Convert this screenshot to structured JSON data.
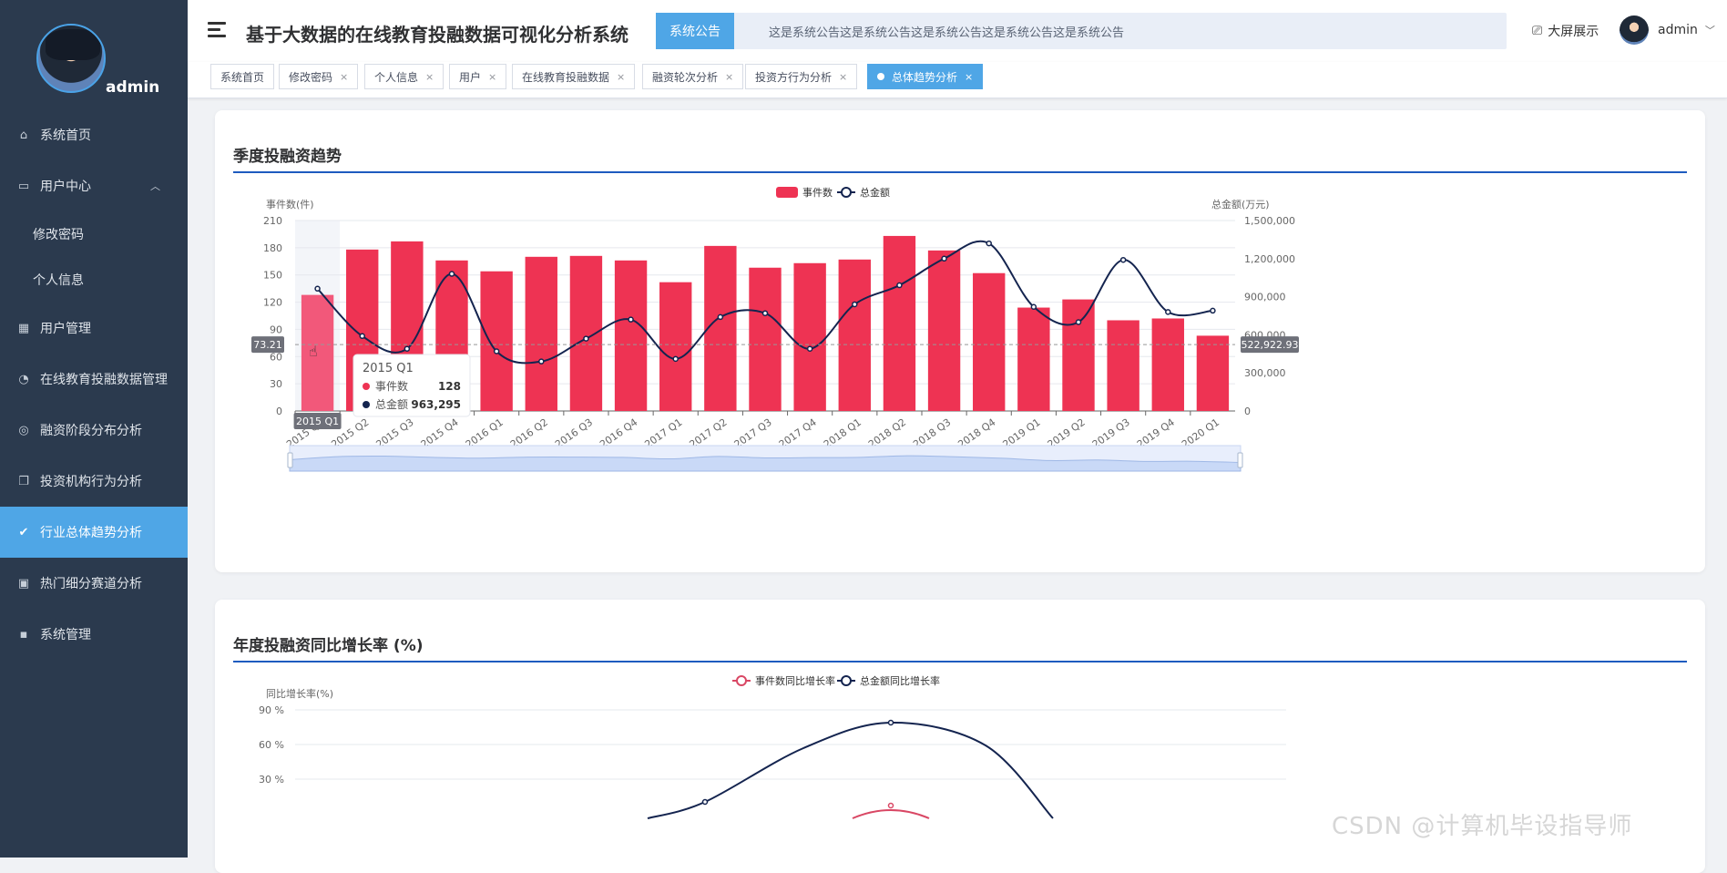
{
  "sidebar": {
    "username": "admin",
    "items": [
      {
        "label": "系统首页",
        "icon": "home-icon",
        "glyph": "⌂"
      },
      {
        "label": "用户中心",
        "icon": "user-center-icon",
        "glyph": "▭"
      },
      {
        "label": "修改密码"
      },
      {
        "label": "个人信息"
      },
      {
        "label": "用户管理",
        "icon": "grid-icon",
        "glyph": "▦"
      },
      {
        "label": "在线教育投融数据管理",
        "icon": "dashboard-icon",
        "glyph": "◔"
      },
      {
        "label": "融资阶段分布分析",
        "icon": "target-icon",
        "glyph": "◎"
      },
      {
        "label": "投资机构行为分析",
        "icon": "copy-icon",
        "glyph": "❐"
      },
      {
        "label": "行业总体趋势分析",
        "icon": "clipboard-check-icon",
        "glyph": "✔"
      },
      {
        "label": "热门细分赛道分析",
        "icon": "briefcase-icon",
        "glyph": "▣"
      },
      {
        "label": "系统管理",
        "icon": "chat-icon",
        "glyph": "▪"
      }
    ]
  },
  "header": {
    "title": "基于大数据的在线教育投融数据可视化分析系统",
    "notice_tag": "系统公告",
    "notice_text": "这是系统公告这是系统公告这是系统公告这是系统公告这是系统公告",
    "bigscreen": "大屏展示",
    "user": "admin"
  },
  "tabs": [
    {
      "label": "系统首页",
      "closable": false
    },
    {
      "label": "修改密码",
      "closable": true
    },
    {
      "label": "个人信息",
      "closable": true
    },
    {
      "label": "用户",
      "closable": true
    },
    {
      "label": "在线教育投融数据",
      "closable": true
    },
    {
      "label": "融资轮次分析",
      "closable": true
    },
    {
      "label": "投资方行为分析",
      "closable": true
    },
    {
      "label": "总体趋势分析",
      "closable": true,
      "active": true
    }
  ],
  "cards": {
    "quarterly_title": "季度投融资趋势",
    "yoy_title": "年度投融资同比增长率 (%)"
  },
  "chart_data": [
    {
      "type": "bar",
      "title": "季度投融资趋势",
      "ylabel_left": "事件数(件)",
      "ylabel_right": "总金额(万元)",
      "ylim_left": [
        0,
        210
      ],
      "yticks_left": [
        "0",
        "30",
        "60",
        "90",
        "120",
        "150",
        "180",
        "210"
      ],
      "ylim_right": [
        0,
        1500000
      ],
      "yticks_right": [
        "0",
        "300,000",
        "600,000",
        "900,000",
        "1,200,000",
        "1,500,000"
      ],
      "legend_position": "top-center",
      "categories": [
        "2015 Q1",
        "2015 Q2",
        "2015 Q3",
        "2015 Q4",
        "2016 Q1",
        "2016 Q2",
        "2016 Q3",
        "2016 Q4",
        "2017 Q1",
        "2017 Q2",
        "2017 Q3",
        "2017 Q4",
        "2018 Q1",
        "2018 Q2",
        "2018 Q3",
        "2018 Q4",
        "2019 Q1",
        "2019 Q2",
        "2019 Q3",
        "2019 Q4",
        "2020 Q1"
      ],
      "series": [
        {
          "name": "事件数",
          "kind": "bar",
          "axis": "left",
          "color": "#ee3353",
          "values": [
            128,
            178,
            187,
            166,
            154,
            170,
            171,
            166,
            142,
            182,
            158,
            163,
            167,
            193,
            177,
            152,
            114,
            123,
            100,
            102,
            83
          ]
        },
        {
          "name": "总金额",
          "kind": "line",
          "axis": "right",
          "color": "#14244f",
          "values": [
            963295,
            590000,
            490000,
            1080000,
            470000,
            390000,
            570000,
            720000,
            410000,
            740000,
            770000,
            490000,
            840000,
            990000,
            1200000,
            1320000,
            820000,
            700000,
            1190000,
            780000,
            790000
          ]
        }
      ],
      "axis_pointer": {
        "left_label": "73.21",
        "right_label": "522,922.93",
        "category_label": "2015 Q1"
      },
      "tooltip": {
        "title": "2015 Q1",
        "rows": [
          {
            "name": "事件数",
            "value": "128"
          },
          {
            "name": "总金额",
            "value": "963,295"
          }
        ]
      }
    },
    {
      "type": "line",
      "title": "年度投融资同比增长率 (%)",
      "ylabel": "同比增长率(%)",
      "yticks": [
        "30 %",
        "60 %",
        "90 %"
      ],
      "ylim": [
        0,
        90
      ],
      "legend_position": "top-center",
      "series": [
        {
          "name": "事件数同比增长率",
          "color": "#d94764"
        },
        {
          "name": "总金额同比增长率",
          "color": "#14244f"
        }
      ]
    }
  ],
  "watermark": "CSDN @计算机毕设指导师"
}
